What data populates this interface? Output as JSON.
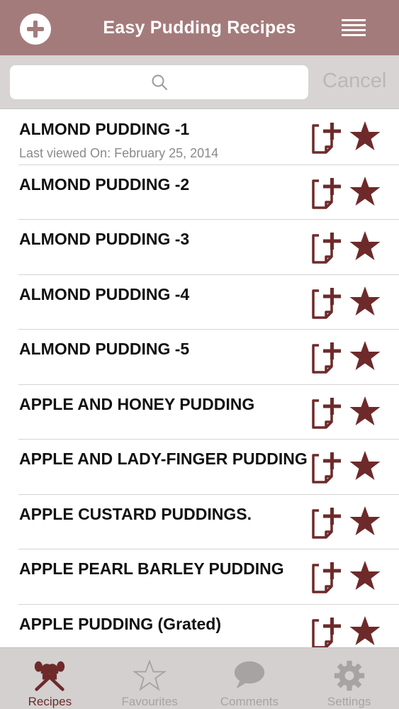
{
  "header": {
    "title": "Easy Pudding Recipes",
    "add_icon": "plus-circle-icon",
    "menu_icon": "hamburger-menu-icon",
    "background": "#a47b7b"
  },
  "search": {
    "placeholder": "",
    "value": "",
    "cancel_label": "Cancel",
    "icon": "search-icon"
  },
  "recipes": [
    {
      "title": "ALMOND PUDDING -1",
      "subtitle": "Last viewed On: February 25, 2014"
    },
    {
      "title": "ALMOND PUDDING -2",
      "subtitle": ""
    },
    {
      "title": "ALMOND PUDDING -3",
      "subtitle": ""
    },
    {
      "title": "ALMOND PUDDING -4",
      "subtitle": ""
    },
    {
      "title": "ALMOND PUDDING -5",
      "subtitle": ""
    },
    {
      "title": "APPLE AND HONEY PUDDING",
      "subtitle": ""
    },
    {
      "title": "APPLE AND LADY-FINGER PUDDING",
      "subtitle": ""
    },
    {
      "title": "APPLE CUSTARD PUDDINGS.",
      "subtitle": ""
    },
    {
      "title": "APPLE PEARL BARLEY PUDDING",
      "subtitle": ""
    },
    {
      "title": "APPLE PUDDING (Grated)",
      "subtitle": ""
    }
  ],
  "row_icons": {
    "note": "add-note-icon",
    "favourite": "star-icon",
    "color": "#6e2a2a"
  },
  "tabs": [
    {
      "label": "Recipes",
      "icon": "chef-hat-utensils-icon",
      "active": true
    },
    {
      "label": "Favourites",
      "icon": "star-outline-icon",
      "active": false
    },
    {
      "label": "Comments",
      "icon": "speech-bubble-icon",
      "active": false
    },
    {
      "label": "Settings",
      "icon": "gear-icon",
      "active": false
    }
  ],
  "colors": {
    "accent": "#6e2a2a",
    "inactive_tab": "#a8a3a3",
    "tabbar_bg": "#d4d0d0"
  }
}
